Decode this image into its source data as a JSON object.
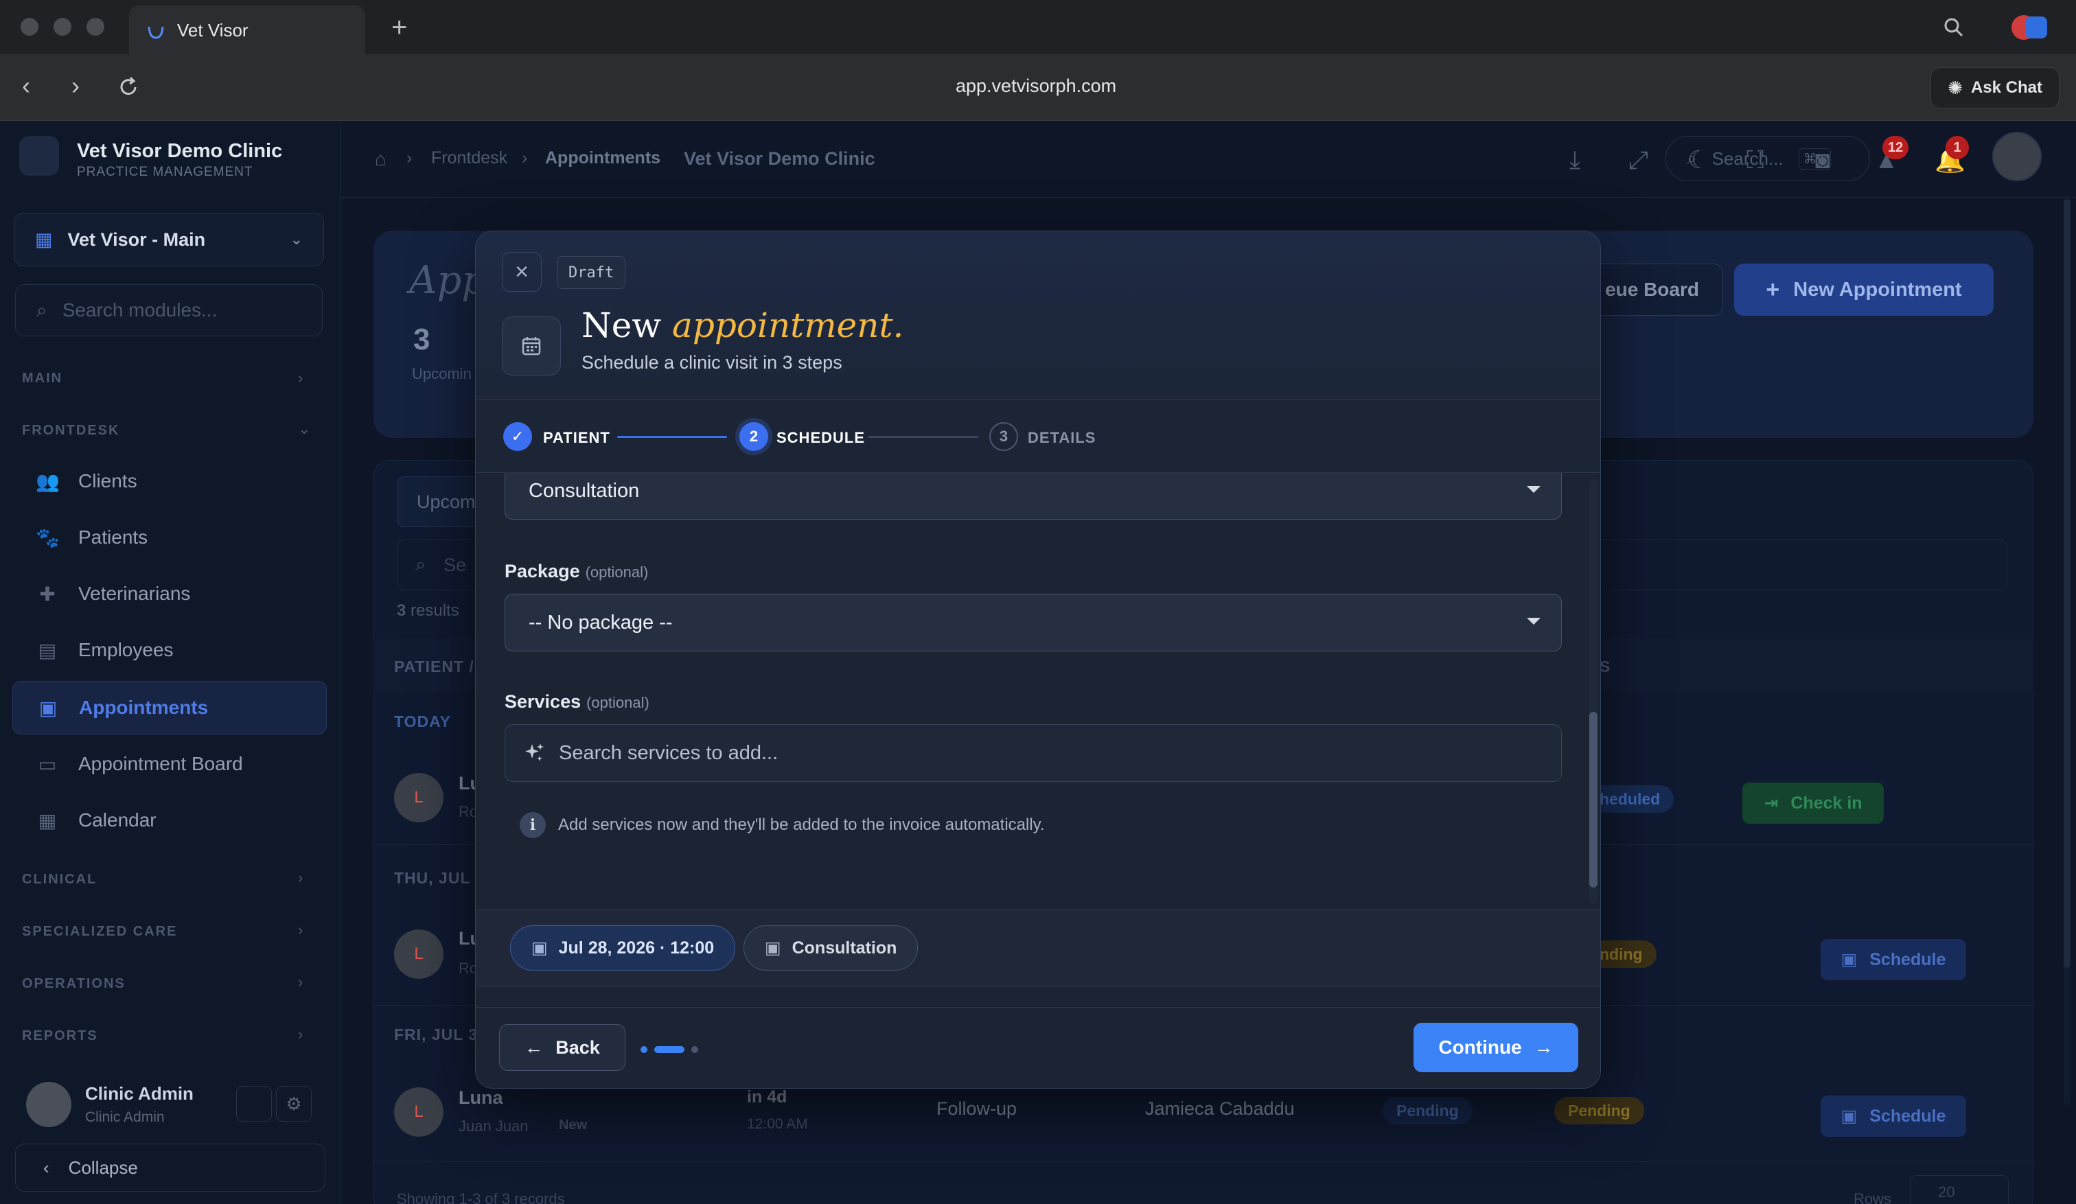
{
  "browser": {
    "tab_title": "Vet Visor",
    "url": "app.vetvisorph.com",
    "ask_chat": "Ask Chat"
  },
  "sidebar": {
    "clinic_name": "Vet Visor Demo Clinic",
    "clinic_sub": "PRACTICE MANAGEMENT",
    "branch": "Vet Visor - Main",
    "search_placeholder": "Search modules...",
    "sections": {
      "main": "MAIN",
      "frontdesk": "FRONTDESK",
      "clinical": "CLINICAL",
      "specialized": "SPECIALIZED CARE",
      "operations": "OPERATIONS",
      "reports": "REPORTS"
    },
    "items": [
      {
        "label": "Clients",
        "icon": "users-icon"
      },
      {
        "label": "Patients",
        "icon": "paw-icon"
      },
      {
        "label": "Veterinarians",
        "icon": "medical-cross-icon"
      },
      {
        "label": "Employees",
        "icon": "briefcase-icon"
      },
      {
        "label": "Appointments",
        "icon": "calendar-icon"
      },
      {
        "label": "Appointment Board",
        "icon": "monitor-icon"
      },
      {
        "label": "Calendar",
        "icon": "calendar-grid-icon"
      }
    ],
    "user_name": "Clinic Admin",
    "user_role": "Clinic Admin",
    "collapse": "Collapse"
  },
  "header": {
    "breadcrumb": [
      "Frontdesk",
      "Appointments"
    ],
    "clinic": "Vet Visor Demo Clinic",
    "search_placeholder": "Search...",
    "search_shortcut": "⌘K",
    "badge_alerts": "12",
    "badge_notifications": "1"
  },
  "page": {
    "title_partial": "App",
    "stat_value": "3",
    "stat_label": "Upcomin",
    "queue_board": "eue Board",
    "new_appointment": "New Appointment",
    "filter_tab": "Upcom",
    "search_partial": "Se",
    "results_count": "3",
    "results_label": "results",
    "col_patient": "PATIENT /",
    "col_status_partial": "S",
    "days": [
      "TODAY",
      "THU, JUL",
      "FRI, JUL 3"
    ],
    "rows": [
      {
        "avatar": "L",
        "name_partial": "Lu",
        "sub_partial": "Ro",
        "status_partial": "heduled",
        "action": "Check in"
      },
      {
        "avatar": "L",
        "name_partial": "Lu",
        "sub_partial": "Ro",
        "status_partial": "nding",
        "action": "Schedule"
      },
      {
        "avatar": "L",
        "name": "Luna",
        "owner": "Juan Juan",
        "tag": "New",
        "when": "in 4d",
        "time": "12:00 AM",
        "type": "Follow-up",
        "vet": "Jamieca Cabaddu",
        "status1": "Pending",
        "status2": "Pending",
        "action": "Schedule"
      }
    ],
    "footer_partial": "Showing 1-3 of 3 records",
    "rows_label": "Rows",
    "rows_value": "20"
  },
  "modal": {
    "draft": "Draft",
    "title_plain": "New",
    "title_accent": "appointment.",
    "subtitle": "Schedule a clinic visit in 3 steps",
    "steps": [
      {
        "num": "✓",
        "label": "PATIENT",
        "state": "done"
      },
      {
        "num": "2",
        "label": "SCHEDULE",
        "state": "active"
      },
      {
        "num": "3",
        "label": "DETAILS",
        "state": "pending"
      }
    ],
    "type_value": "Consultation",
    "package_label": "Package",
    "package_optional": "(optional)",
    "package_value": "-- No package --",
    "services_label": "Services",
    "services_optional": "(optional)",
    "services_placeholder": "Search services to add...",
    "hint": "Add services now and they'll be added to the invoice automatically.",
    "chip_datetime": "Jul 28, 2026 · 12:00",
    "chip_type": "Consultation",
    "back": "Back",
    "continue": "Continue"
  },
  "colors": {
    "accent": "#3b82f6",
    "title_accent": "#f4b942",
    "pending": "#eab308",
    "success": "#22c55e"
  }
}
